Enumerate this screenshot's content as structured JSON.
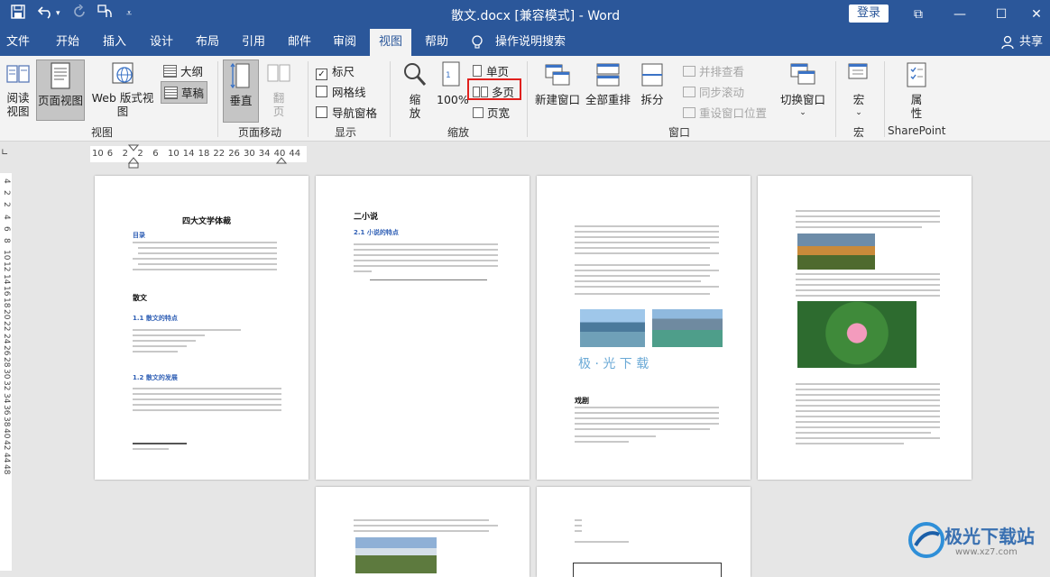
{
  "titlebar": {
    "title": "散文.docx [兼容模式]  -  Word",
    "login": "登录",
    "save_icon": "save-icon",
    "undo_icon": "undo-icon",
    "redo_icon": "redo-icon",
    "touch_icon": "touch-mode-icon",
    "customize_icon": "customize-icon",
    "minimize": "—",
    "maximize": "☐",
    "close": "✕",
    "ribbon_display": "⧉"
  },
  "tabs": [
    "文件",
    "开始",
    "插入",
    "设计",
    "布局",
    "引用",
    "邮件",
    "审阅",
    "视图",
    "帮助",
    "操作说明搜索"
  ],
  "share": "共享",
  "ribbon": {
    "views": {
      "read": "阅读\n视图",
      "print_layout": "页面视图",
      "web": "Web 版式视图",
      "outline": "大纲",
      "draft": "草稿",
      "label": "视图"
    },
    "page_move": {
      "vertical": "垂直",
      "flip": "翻\n页",
      "label": "页面移动"
    },
    "show": {
      "ruler": "标尺",
      "gridlines": "网格线",
      "nav_pane": "导航窗格",
      "label": "显示",
      "ruler_checked": true
    },
    "zoom": {
      "zoom": "缩\n放",
      "percent": "100%",
      "one_page": "单页",
      "multi_page": "多页",
      "page_width": "页宽",
      "label": "缩放"
    },
    "window": {
      "new_window": "新建窗口",
      "arrange_all": "全部重排",
      "split": "拆分",
      "side_by_side": "并排查看",
      "sync_scroll": "同步滚动",
      "reset_position": "重设窗口位置",
      "switch": "切换窗口",
      "label": "窗口"
    },
    "macros": {
      "label": "宏",
      "button": "宏"
    },
    "sharepoint": {
      "props": "属\n性",
      "label": "SharePoint"
    }
  },
  "ruler": {
    "h_ticks": [
      "10",
      "6",
      "2",
      "2",
      "6",
      "10",
      "14",
      "18",
      "22",
      "26",
      "30",
      "34",
      "40",
      "44"
    ],
    "v_ticks": [
      "4",
      "2",
      "2",
      "4",
      "6",
      "8",
      "10",
      "12",
      "14",
      "16",
      "18",
      "20",
      "22",
      "24",
      "26",
      "28",
      "30",
      "32",
      "34",
      "36",
      "38",
      "40",
      "42",
      "44",
      "48"
    ]
  },
  "pages": {
    "p1_title": "四大文学体裁",
    "p1_toc": "目录",
    "p1_h1": "散文",
    "p1_h2a": "1.1 散文的特点",
    "p1_h2b": "1.2 散文的发展",
    "p2_h1": "二小说",
    "p2_h2": "2.1 小说的特点",
    "p3_caption": "极 · 光 下 载",
    "p3_h": "戏剧"
  },
  "watermark": {
    "text": "极光下载站",
    "url": "www.xz7.com"
  }
}
